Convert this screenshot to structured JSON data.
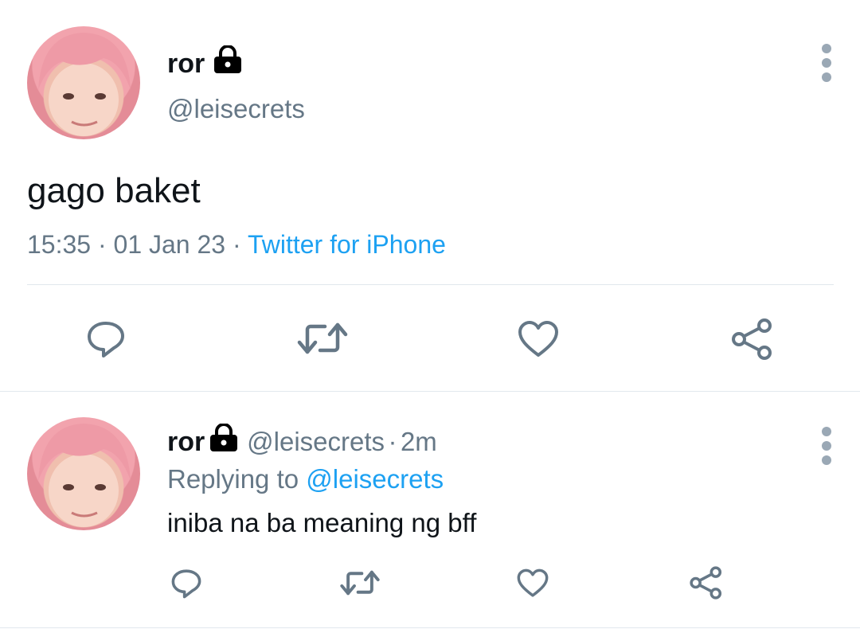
{
  "main_tweet": {
    "display_name": "ror",
    "handle": "@leisecrets",
    "text": "gago baket",
    "time": "15:35",
    "separator": "·",
    "date": "01 Jan 23",
    "source": "Twitter for iPhone",
    "icons": [
      "lock-icon",
      "more-icon",
      "reply-icon",
      "retweet-icon",
      "like-icon",
      "share-icon"
    ]
  },
  "reply_tweet": {
    "display_name": "ror",
    "handle": "@leisecrets",
    "separator": "·",
    "time_ago": "2m",
    "replying_to_label": "Replying to",
    "replying_to_handle": "@leisecrets",
    "text": "iniba na ba meaning ng bff"
  },
  "colors": {
    "icon_gray": "#657786",
    "link_blue": "#1da1f2",
    "divider": "#e1e8ed"
  }
}
